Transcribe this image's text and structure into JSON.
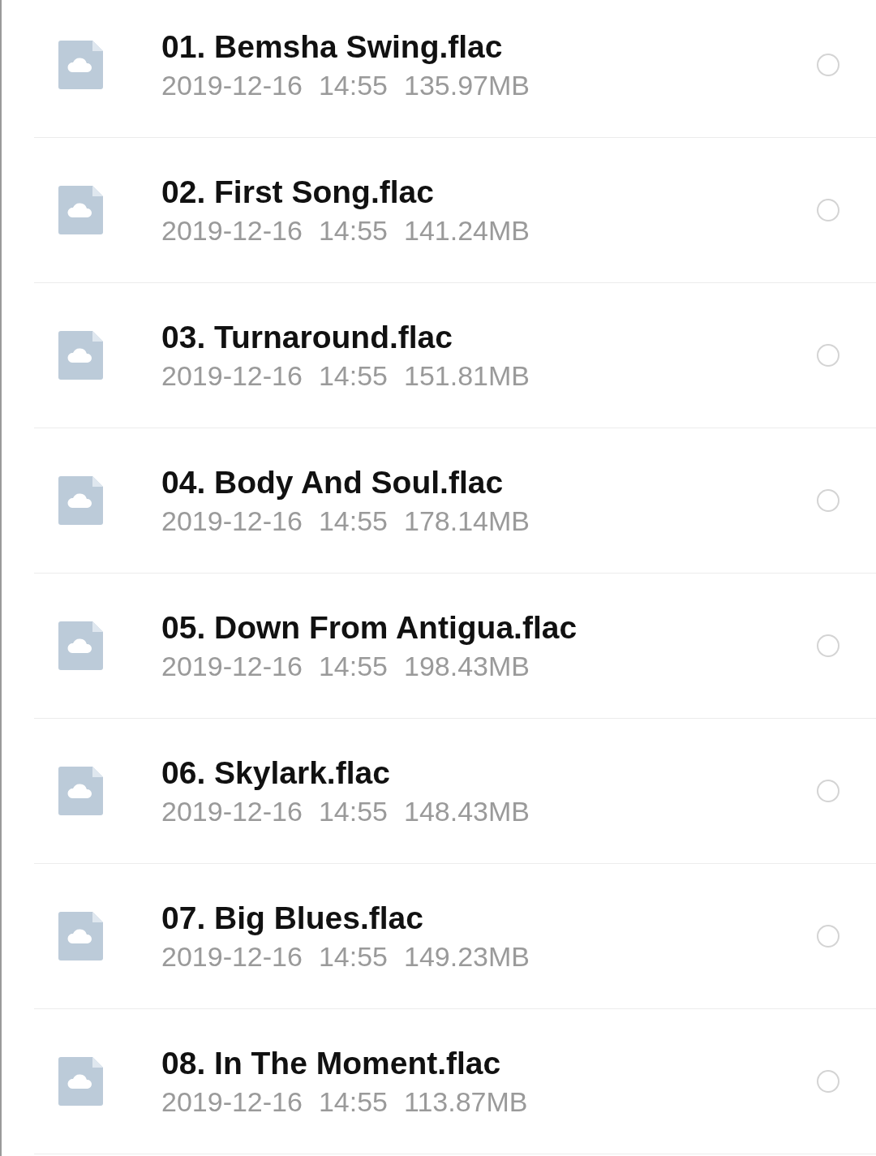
{
  "files": [
    {
      "name": "01. Bemsha Swing.flac",
      "date": "2019-12-16",
      "time": "14:55",
      "size": "135.97MB",
      "selected": false
    },
    {
      "name": "02. First Song.flac",
      "date": "2019-12-16",
      "time": "14:55",
      "size": "141.24MB",
      "selected": false
    },
    {
      "name": "03. Turnaround.flac",
      "date": "2019-12-16",
      "time": "14:55",
      "size": "151.81MB",
      "selected": false
    },
    {
      "name": "04. Body And Soul.flac",
      "date": "2019-12-16",
      "time": "14:55",
      "size": "178.14MB",
      "selected": false
    },
    {
      "name": "05. Down From Antigua.flac",
      "date": "2019-12-16",
      "time": "14:55",
      "size": "198.43MB",
      "selected": false
    },
    {
      "name": "06. Skylark.flac",
      "date": "2019-12-16",
      "time": "14:55",
      "size": "148.43MB",
      "selected": false
    },
    {
      "name": "07. Big Blues.flac",
      "date": "2019-12-16",
      "time": "14:55",
      "size": "149.23MB",
      "selected": false
    },
    {
      "name": "08. In The Moment.flac",
      "date": "2019-12-16",
      "time": "14:55",
      "size": "113.87MB",
      "selected": false
    }
  ]
}
